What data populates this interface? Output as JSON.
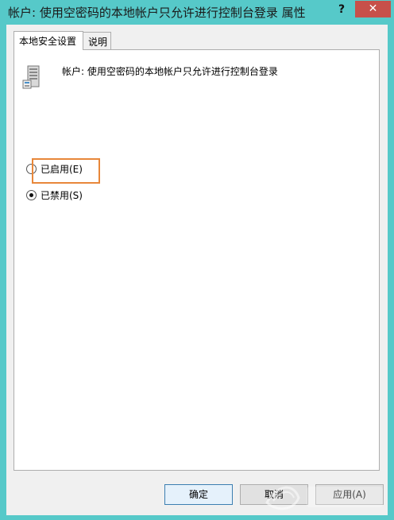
{
  "window": {
    "title": "帐户: 使用空密码的本地帐户只允许进行控制台登录 属性",
    "help_label": "?",
    "close_label": "✕"
  },
  "tabs": [
    {
      "label": "本地安全设置"
    },
    {
      "label": "说明"
    }
  ],
  "policy": {
    "icon": "server-icon",
    "name": "帐户: 使用空密码的本地帐户只允许进行控制台登录"
  },
  "options": [
    {
      "label": "已启用(E)",
      "checked": false
    },
    {
      "label": "已禁用(S)",
      "checked": true
    }
  ],
  "buttons": {
    "ok": "确定",
    "cancel": "取消",
    "apply": "应用(A)"
  },
  "colors": {
    "titlebar": "#56c9c9",
    "close": "#c7504a",
    "highlight": "#e8873a"
  }
}
